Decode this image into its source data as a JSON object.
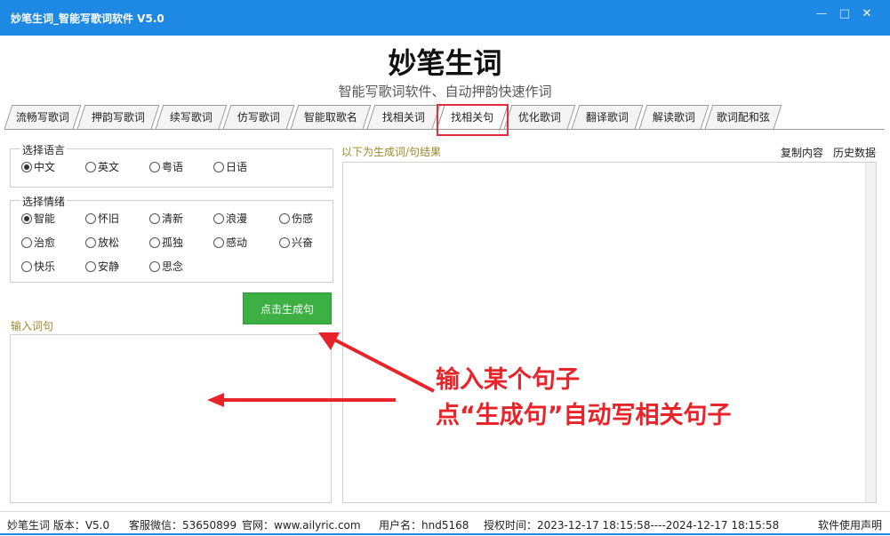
{
  "window": {
    "title": "妙笔生词_智能写歌词软件 V5.0",
    "minimize_label": "—",
    "maximize_label": "□",
    "close_label": "✕"
  },
  "header": {
    "title": "妙笔生词",
    "subtitle": "智能写歌词软件、自动押韵快速作词"
  },
  "tabs": [
    {
      "label": "流畅写歌词"
    },
    {
      "label": "押韵写歌词"
    },
    {
      "label": "续写歌词"
    },
    {
      "label": "仿写歌词"
    },
    {
      "label": "智能取歌名"
    },
    {
      "label": "找相关词"
    },
    {
      "label": "找相关句",
      "active": true
    },
    {
      "label": "优化歌词"
    },
    {
      "label": "翻译歌词"
    },
    {
      "label": "解读歌词"
    },
    {
      "label": "歌词配和弦"
    }
  ],
  "language_group": {
    "title": "选择语言",
    "options": [
      {
        "label": "中文",
        "selected": true
      },
      {
        "label": "英文",
        "selected": false
      },
      {
        "label": "粤语",
        "selected": false
      },
      {
        "label": "日语",
        "selected": false
      }
    ]
  },
  "mood_group": {
    "title": "选择情绪",
    "options": [
      {
        "label": "智能",
        "selected": true
      },
      {
        "label": "怀旧",
        "selected": false
      },
      {
        "label": "清新",
        "selected": false
      },
      {
        "label": "浪漫",
        "selected": false
      },
      {
        "label": "伤感",
        "selected": false
      },
      {
        "label": "治愈",
        "selected": false
      },
      {
        "label": "放松",
        "selected": false
      },
      {
        "label": "孤独",
        "selected": false
      },
      {
        "label": "感动",
        "selected": false
      },
      {
        "label": "兴奋",
        "selected": false
      },
      {
        "label": "快乐",
        "selected": false
      },
      {
        "label": "安静",
        "selected": false
      },
      {
        "label": "思念",
        "selected": false
      }
    ]
  },
  "generate_button": "点击生成句",
  "input_label": "输入词句",
  "input_value": "",
  "result_label": "以下为生成词/句结果",
  "result_value": "",
  "copy_label": "复制内容",
  "history_label": "历史数据",
  "annotation": {
    "line1": "输入某个句子",
    "line2": "点“生成句”自动写相关句子",
    "color": "#e8242a"
  },
  "status": {
    "version": "妙笔生词 版本：V5.0",
    "wechat": "客服微信：53650899",
    "website": "官网：www.ailyric.com",
    "username": "用户名：hnd5168",
    "license": "授权时间：2023-12-17 18:15:58----2024-12-17 18:15:58",
    "disclaimer": "软件使用声明"
  },
  "colors": {
    "titlebar": "#1e88e5",
    "button_green": "#3cb043",
    "highlight_red": "#e0303a"
  }
}
